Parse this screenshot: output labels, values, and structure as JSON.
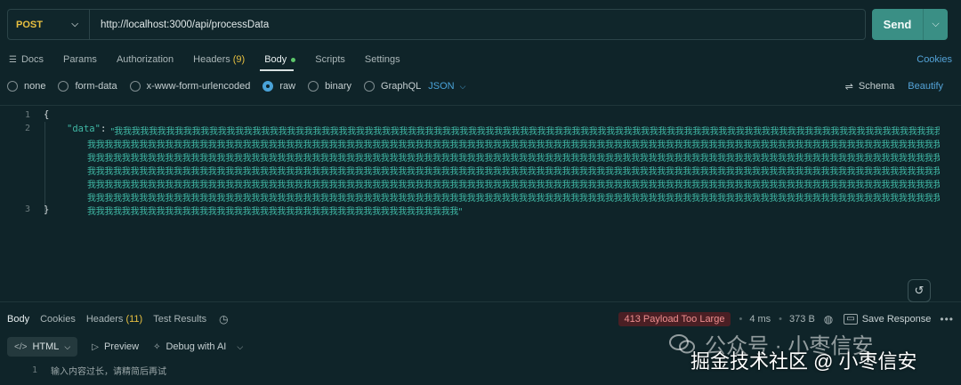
{
  "request": {
    "method": "POST",
    "url": "http://localhost:3000/api/processData",
    "send_label": "Send"
  },
  "tabs": {
    "items": [
      {
        "label": "Docs"
      },
      {
        "label": "Params"
      },
      {
        "label": "Authorization"
      },
      {
        "label": "Headers",
        "count": "(9)"
      },
      {
        "label": "Body"
      },
      {
        "label": "Scripts"
      },
      {
        "label": "Settings"
      }
    ],
    "cookies_label": "Cookies"
  },
  "body_types": {
    "options": [
      "none",
      "form-data",
      "x-www-form-urlencoded",
      "raw",
      "binary",
      "GraphQL"
    ],
    "selected": "raw",
    "format": "JSON",
    "schema_label": "Schema",
    "beautify_label": "Beautify"
  },
  "editor": {
    "line_numbers": [
      "1",
      "2",
      "3"
    ],
    "open_brace": "{",
    "close_brace": "}",
    "key": "\"data\"",
    "colon": ":",
    "value_lines": [
      "\"我我我我我我我我我我我我我我我我我我我我我我我我我我我我我我我我我我我我我我我我我我我我我我我我我我我我我我我我我我我我我我我我我我我我我我我我我我我我我我我我我我我我我我我我我我我我我我我我我我我我我我我我我",
      "我我我我我我我我我我我我我我我我我我我我我我我我我我我我我我我我我我我我我我我我我我我我我我我我我我我我我我我我我我我我我我我我我我我我我我我我我我我我我我我我我我我我我我我我我我我我我我我我我我我我我我我",
      "我我我我我我我我我我我我我我我我我我我我我我我我我我我我我我我我我我我我我我我我我我我我我我我我我我我我我我我我我我我我我我我我我我我我我我我我我我我我我我我我我我我我我我我我我我我我我我我我我我我我我我",
      "我我我我我我我我我我我我我我我我我我我我我我我我我我我我我我我我我我我我我我我我我我我我我我我我我我我我我我我我我我我我我我我我我我我我我我我我我我我我我我我我我我我我我我我我我我我我我我我我我我我我我我",
      "我我我我我我我我我我我我我我我我我我我我我我我我我我我我我我我我我我我我我我我我我我我我我我我我我我我我我我我我我我我我我我我我我我我我我我我我我我我我我我我我我我我我我我我我我我我我我我我我我我我我我我",
      "我我我我我我我我我我我我我我我我我我我我我我我我我我我我我我我我我我我我我我我我我我我我我我我我我我我我我我我我我我我我我我我我我我我我我我我我我我我我我我我我我我我我我我我我我我我我我我我我我我我我我我",
      "我我我我我我我我我我我我我我我我我我我我我我我我我我我我我我我我我我我我我我我我我我我\""
    ]
  },
  "response": {
    "tabs": [
      {
        "label": "Body"
      },
      {
        "label": "Cookies"
      },
      {
        "label": "Headers",
        "count": "(11)"
      },
      {
        "label": "Test Results"
      }
    ],
    "status": "413 Payload Too Large",
    "time": "4 ms",
    "size": "373 B",
    "save_label": "Save Response",
    "format": "HTML",
    "preview_label": "Preview",
    "debug_label": "Debug with AI",
    "line_number": "1",
    "body_text": "输入内容过长，请精简后再试"
  },
  "watermark": {
    "top_text": "公众号 · 小枣信安",
    "bottom_text": "掘金技术社区 @ 小枣信安"
  },
  "colors": {
    "background": "#0f2429",
    "accent": "#3a8f85",
    "method": "#e8c040",
    "link": "#54a3d8",
    "string": "#3fb8a5",
    "error": "#ef8f8f"
  },
  "icons": [
    "chevron-down-icon",
    "history-icon",
    "clock-icon",
    "globe-icon",
    "save-icon",
    "more-icon",
    "code-icon",
    "play-icon",
    "ai-icon",
    "schema-icon",
    "wechat-icon"
  ]
}
